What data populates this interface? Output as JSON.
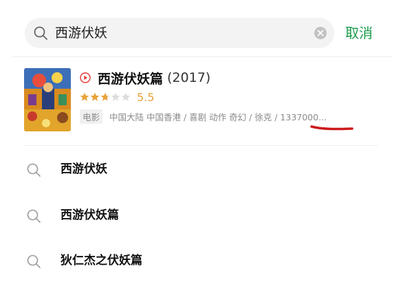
{
  "search": {
    "query": "西游伏妖",
    "cancel_label": "取消"
  },
  "movie_result": {
    "title": "西游伏妖篇",
    "year": "(2017)",
    "rating": "5.5",
    "stars_filled_fraction": 0.55,
    "type_badge": "电影",
    "info": "中国大陆 中国香港 / 喜剧 动作 奇幻 / 徐克 / 1337000...",
    "accent_color": "#e8a33a",
    "highlight_color": "#cc1a1a"
  },
  "suggestions": [
    {
      "label": "西游伏妖"
    },
    {
      "label": "西游伏妖篇"
    },
    {
      "label": "狄仁杰之伏妖篇"
    }
  ],
  "colors": {
    "brand_green": "#1a9c4a",
    "search_bg": "#f2f3f2"
  }
}
